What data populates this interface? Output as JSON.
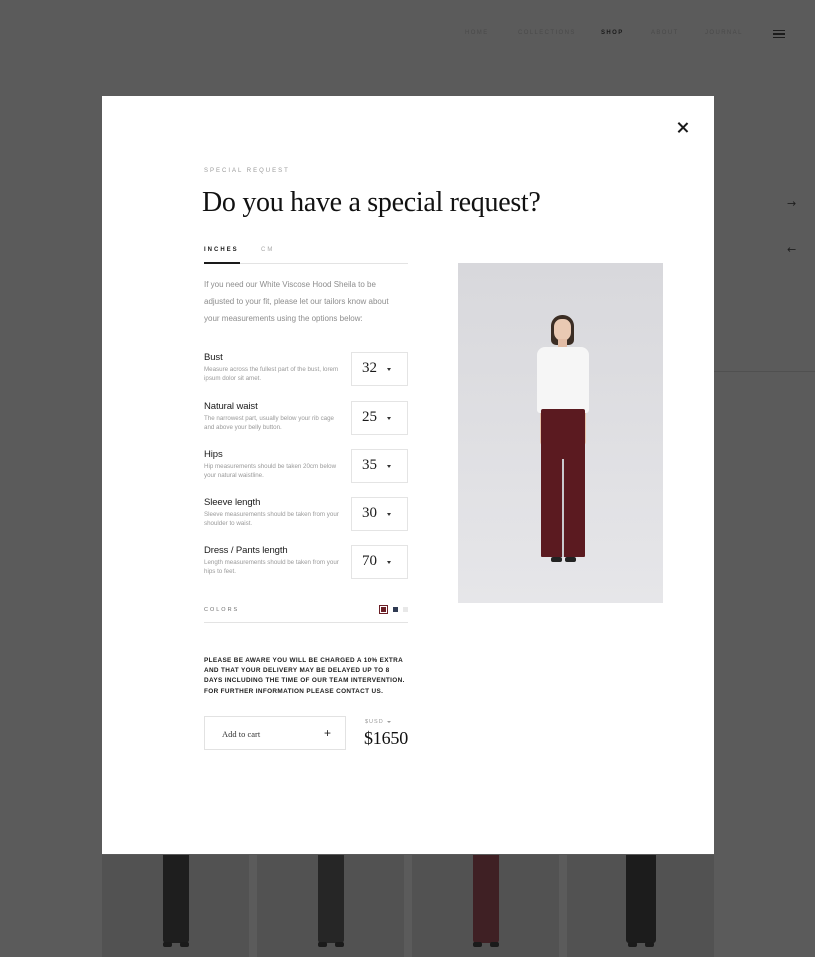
{
  "nav": {
    "items": [
      "HOME",
      "COLLECTIONS",
      "SHOP",
      "ABOUT",
      "JOURNAL"
    ],
    "active": "SHOP"
  },
  "icons": {
    "menu": "hamburger-icon",
    "next": "arrow-right-icon",
    "prev": "arrow-left-icon",
    "close": "close-icon",
    "add": "plus-icon"
  },
  "modal": {
    "eyebrow": "SPECIAL REQUEST",
    "title": "Do you have a special request?",
    "tabs": [
      {
        "label": "INCHES",
        "active": true
      },
      {
        "label": "CM",
        "active": false
      }
    ],
    "intro": "If you need our White Viscose Hood Sheila to be adjusted to your fit, please let our tailors know about your measurements using the options below:",
    "measurements": [
      {
        "label": "Bust",
        "description": "Measure across the fullest part of the bust, lorem ipsum dolor sit amet.",
        "value": "32"
      },
      {
        "label": "Natural waist",
        "description": "The narrowest part, usually below your rib  cage and above your belly button.",
        "value": "25"
      },
      {
        "label": "Hips",
        "description": "Hip measurements should be taken 20cm below your natural waistline.",
        "value": "35"
      },
      {
        "label": "Sleeve length",
        "description": "Sleeve measurements should be taken from your shoulder to waist.",
        "value": "30"
      },
      {
        "label": "Dress / Pants length",
        "description": "Length measurements should be taken from your hips to feet.",
        "value": "70"
      }
    ],
    "colors_label": "COLORS",
    "colors": [
      "#6b1f26",
      "#2f3a52",
      "#e8e8e8"
    ],
    "notice": "PLEASE BE AWARE YOU WILL BE CHARGED A 10% EXTRA AND THAT YOUR DELIVERY MAY BE DELAYED UP TO 8 DAYS INCLUDING THE TIME OF OUR TEAM INTERVENTION. FOR FURTHER INFORMATION PLEASE CONTACT US.",
    "add_to_cart": "Add to cart",
    "add_symbol": "+",
    "currency": "$USD",
    "price": "$1650"
  },
  "colors": {
    "overlay_bg": "#5b5b5b",
    "modal_bg": "#ffffff",
    "text_dark": "#111111",
    "text_muted": "#9a9a9a",
    "pants": "#5b1a20"
  }
}
